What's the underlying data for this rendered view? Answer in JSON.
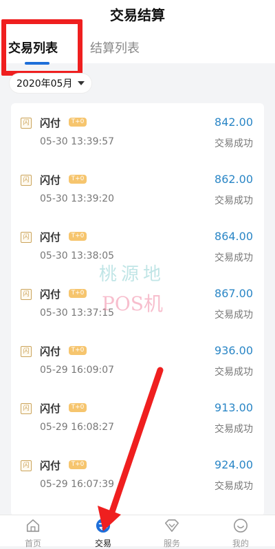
{
  "page": {
    "title": "交易结算"
  },
  "tabs": [
    {
      "label": "交易列表"
    },
    {
      "label": "结算列表"
    }
  ],
  "filter": {
    "month": "2020年05月"
  },
  "rows": [
    {
      "icon_text": "闪",
      "name": "闪付",
      "badge": "T+0",
      "time": "05-30 13:39:57",
      "amount": "842.00",
      "status": "交易成功"
    },
    {
      "icon_text": "闪",
      "name": "闪付",
      "badge": "T+0",
      "time": "05-30 13:39:20",
      "amount": "862.00",
      "status": "交易成功"
    },
    {
      "icon_text": "闪",
      "name": "闪付",
      "badge": "T+0",
      "time": "05-30 13:38:05",
      "amount": "864.00",
      "status": "交易成功"
    },
    {
      "icon_text": "闪",
      "name": "闪付",
      "badge": "T+0",
      "time": "05-30 13:37:15",
      "amount": "867.00",
      "status": "交易成功"
    },
    {
      "icon_text": "闪",
      "name": "闪付",
      "badge": "T+0",
      "time": "05-29 16:09:07",
      "amount": "936.00",
      "status": "交易成功"
    },
    {
      "icon_text": "闪",
      "name": "闪付",
      "badge": "T+0",
      "time": "05-29 16:08:27",
      "amount": "913.00",
      "status": "交易成功"
    },
    {
      "icon_text": "闪",
      "name": "闪付",
      "badge": "T+0",
      "time": "05-29 16:07:39",
      "amount": "924.00",
      "status": "交易成功"
    }
  ],
  "watermark": {
    "line1": "桃源地",
    "line2": "POS机"
  },
  "nav": [
    {
      "label": "首页",
      "icon": "home-icon"
    },
    {
      "label": "交易",
      "icon": "exchange-icon"
    },
    {
      "label": "服务",
      "icon": "diamond-icon"
    },
    {
      "label": "我的",
      "icon": "smile-icon"
    }
  ],
  "colors": {
    "accent": "#1e6fd9",
    "amount": "#2a86c6",
    "highlight": "#ef1f1f",
    "badge": "#f6c56e"
  }
}
